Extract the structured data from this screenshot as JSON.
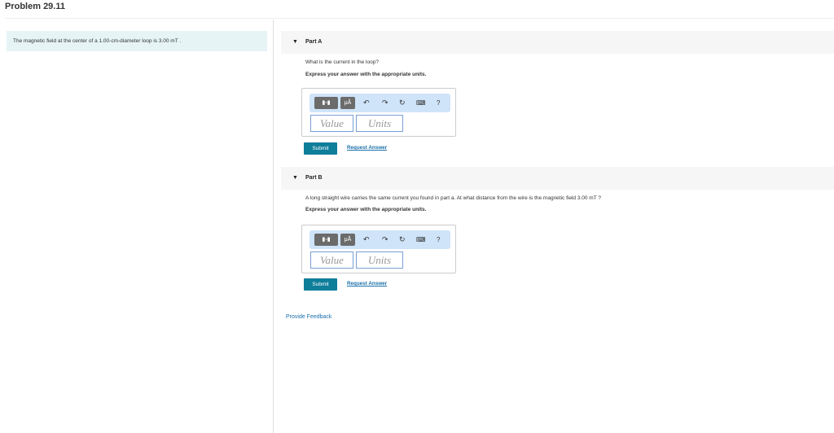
{
  "title": "Problem 29.11",
  "intro": "The magnetic field at the center of a 1.00-cm-diameter loop is 3.00 mT .",
  "parts": [
    {
      "label": "Part A",
      "question": "What is the current in the loop?",
      "express": "Express your answer with the appropriate units.",
      "value_placeholder": "Value",
      "units_placeholder": "Units",
      "unit_btn": "μÅ",
      "help": "?",
      "submit": "Submit",
      "request": "Request Answer"
    },
    {
      "label": "Part B",
      "question": "A long straight wire carries the same current you found in part a. At what distance from the wire is the magnetic field 3.00 mT ?",
      "express": "Express your answer with the appropriate units.",
      "value_placeholder": "Value",
      "units_placeholder": "Units",
      "unit_btn": "μÅ",
      "help": "?",
      "submit": "Submit",
      "request": "Request Answer"
    }
  ],
  "feedback": "Provide Feedback"
}
